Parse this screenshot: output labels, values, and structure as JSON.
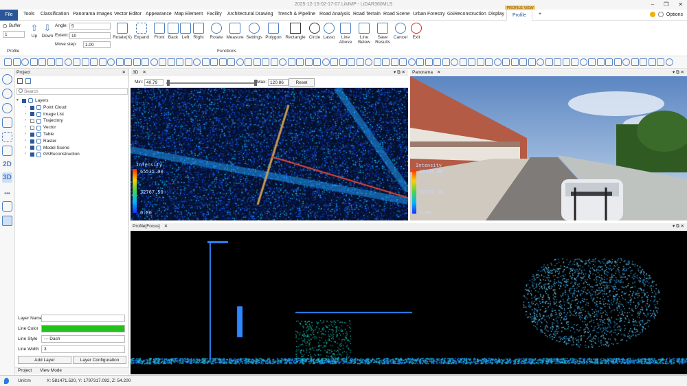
{
  "window": {
    "title": "2025-12-15-02-17-07.LiMMP - LiDAR360MLS"
  },
  "menu": {
    "file": "File",
    "tabs": [
      "Tools",
      "Classification",
      "Panorama Images",
      "Vector Editor",
      "Appearance",
      "Map Element",
      "Facility",
      "Architectural Drawing",
      "Trench & Pipeline",
      "Road Analysis",
      "Road Terrain",
      "Road Scene",
      "Urban Forestry",
      "GSReconstruction",
      "Display"
    ],
    "context_header": "PROFILE VIEW",
    "active_tab": "Profile",
    "add_tab": "+",
    "options": "Options"
  },
  "ribbon": {
    "buffer_label": "Buffer",
    "buffer_value": "1",
    "up": "Up",
    "down": "Down",
    "angle_label": "Angle:",
    "angle_value": "5",
    "extent_label": "Extent:",
    "extent_value": "10",
    "movestep_label": "Move step:",
    "movestep_value": "1.00",
    "rotate": "Rotate(X)",
    "expand": "Expand",
    "views": [
      "Front",
      "Back",
      "Left",
      "Right"
    ],
    "functions": [
      "Rotate",
      "Measure",
      "Settings",
      "Polygon",
      "Rectangle",
      "Circle",
      "Lasso"
    ],
    "line_above": "Line Above",
    "line_below": "Line Below",
    "save_results": "Save Results",
    "cancel": "Cancel",
    "exit": "Exit",
    "group_profile": "Profile",
    "group_functions": "Functions"
  },
  "project": {
    "title": "Project",
    "search_placeholder": "Search",
    "tree": [
      {
        "label": "Layers",
        "checked": true,
        "level": 0
      },
      {
        "label": "Point Cloud",
        "checked": true,
        "level": 1
      },
      {
        "label": "Image List",
        "checked": true,
        "level": 1
      },
      {
        "label": "Trajectory",
        "checked": false,
        "level": 1
      },
      {
        "label": "Vector",
        "checked": false,
        "level": 1
      },
      {
        "label": "Table",
        "checked": true,
        "level": 1
      },
      {
        "label": "Raster",
        "checked": true,
        "level": 1
      },
      {
        "label": "Model Scene",
        "checked": true,
        "level": 1
      },
      {
        "label": "GSReconstruction",
        "checked": true,
        "level": 1
      }
    ],
    "props": {
      "layer_name_label": "Layer Name",
      "layer_name_value": "",
      "line_color_label": "Line Color",
      "line_color": "#22c21a",
      "line_style_label": "Line Style",
      "line_style_value": "--- Dash",
      "line_width_label": "Line Width",
      "line_width_value": "3"
    },
    "add_layer": "Add Layer",
    "layer_config": "Layer Configuration",
    "bottom_tabs": [
      "Project",
      "View Mode"
    ]
  },
  "view3d": {
    "tab": "3D",
    "min_label": "Min:",
    "min_value": "40.79",
    "max_label": "Max:",
    "max_value": "120.86",
    "reset": "Reset",
    "legend_title": "Intensity",
    "legend_top": "65535.00",
    "legend_mid": "32767.50",
    "legend_bot": "0.00"
  },
  "panorama": {
    "tab": "Panorama",
    "legend_title": "Intensity",
    "legend_top": "65535.00",
    "legend_mid": "32767.50",
    "legend_bot": "0.00"
  },
  "profile": {
    "tab": "Profile[Focus]"
  },
  "status": {
    "unit": "Unit:m",
    "coords": "X: 581471.520, Y: 1797317.092, Z: 54.200"
  }
}
